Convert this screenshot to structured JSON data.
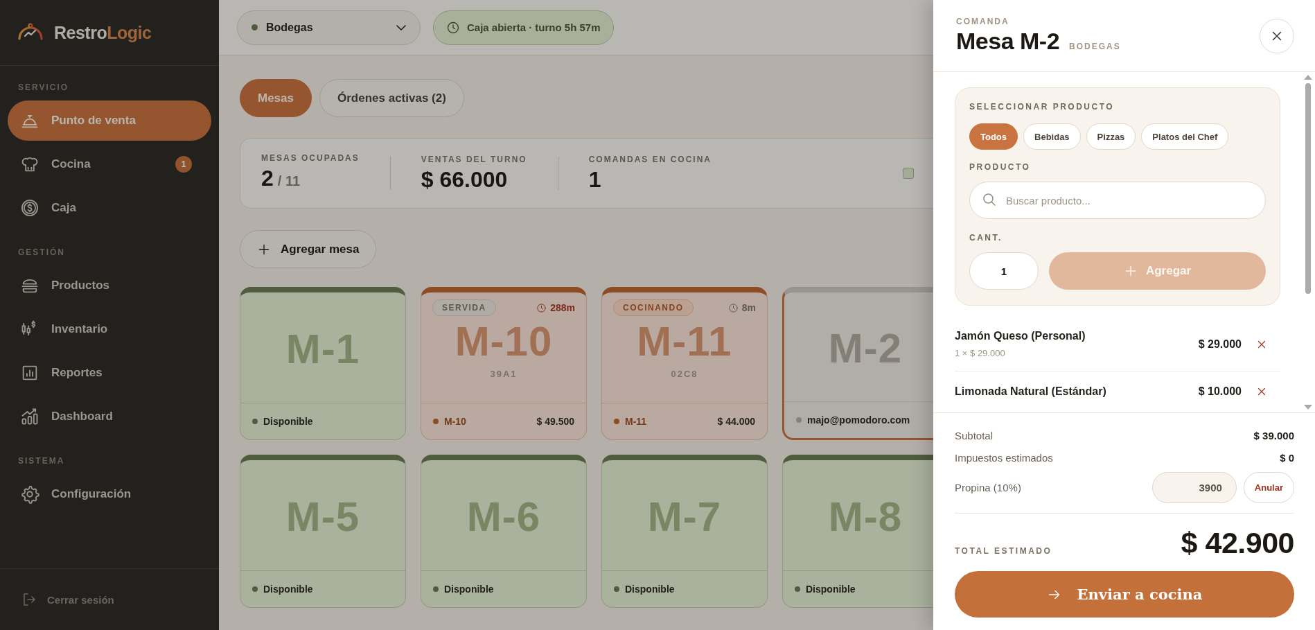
{
  "sidebar": {
    "brand": {
      "name": "Restro",
      "name_accent": "Logic"
    },
    "sections": [
      {
        "title": "SERVICIO",
        "items": [
          {
            "label": "Punto de venta",
            "selected": true
          },
          {
            "label": "Cocina",
            "selected": false,
            "badge": "1"
          },
          {
            "label": "Caja",
            "selected": false
          }
        ]
      },
      {
        "title": "GESTIÓN",
        "items": [
          {
            "label": "Productos",
            "selected": false
          },
          {
            "label": "Inventario",
            "selected": false
          },
          {
            "label": "Reportes",
            "selected": false
          },
          {
            "label": "Dashboard",
            "selected": false
          }
        ]
      },
      {
        "title": "SISTEMA",
        "items": [
          {
            "label": "Configuración",
            "selected": false
          }
        ]
      }
    ],
    "logout": "Cerrar sesión"
  },
  "topbar": {
    "location": {
      "value": "Bodegas"
    },
    "shift_status": "Caja abierta · turno 5h 57m"
  },
  "tabs": [
    {
      "label": "Mesas",
      "selected": true
    },
    {
      "label": "Órdenes activas (2)",
      "selected": false
    }
  ],
  "stats": [
    {
      "label": "MESAS OCUPADAS",
      "value": "2",
      "total": "/ 11"
    },
    {
      "label": "VENTAS DEL TURNO",
      "value": "$ 66.000"
    },
    {
      "label": "COMANDAS EN COCINA",
      "value": "1"
    }
  ],
  "add_table_button": "Agregar mesa",
  "tables": [
    {
      "name": "M-1",
      "kind": "available",
      "selected": false,
      "footer": "Disponible"
    },
    {
      "name": "M-10",
      "kind": "occupied",
      "selected": false,
      "badge": {
        "label": "SERVIDA",
        "kind": "served"
      },
      "timer": "288m",
      "timer_overdue": true,
      "code": "39A1",
      "footer": "M-10",
      "amount": "$ 49.500"
    },
    {
      "name": "M-11",
      "kind": "occupied",
      "selected": false,
      "badge": {
        "label": "COCINANDO",
        "kind": "cooking"
      },
      "timer": "8m",
      "timer_overdue": false,
      "code": "02C8",
      "footer": "M-11",
      "amount": "$ 44.000"
    },
    {
      "name": "M-2",
      "kind": "open",
      "selected": true,
      "footer": "majo@pomodoro.com"
    },
    {
      "name": "M-5",
      "kind": "available",
      "selected": false,
      "footer": "Disponible"
    },
    {
      "name": "M-6",
      "kind": "available",
      "selected": false,
      "footer": "Disponible"
    },
    {
      "name": "M-7",
      "kind": "available",
      "selected": false,
      "footer": "Disponible"
    },
    {
      "name": "M-8",
      "kind": "available",
      "selected": false,
      "footer": "Disponible"
    }
  ],
  "order_panel": {
    "eyebrow": "COMANDA",
    "title": "Mesa M-2",
    "subtitle": "BODEGAS",
    "selector_title": "SELECCIONAR PRODUCTO",
    "categories": [
      {
        "label": "Todos",
        "selected": true
      },
      {
        "label": "Bebidas",
        "selected": false
      },
      {
        "label": "Pizzas",
        "selected": false
      },
      {
        "label": "Platos del Chef",
        "selected": false
      }
    ],
    "product_label": "PRODUCTO",
    "product_search": {
      "placeholder": "Buscar producto..."
    },
    "quantity_label": "CANT.",
    "quantity": "1",
    "add_button": {
      "label": "Agregar",
      "disabled": true
    },
    "items": [
      {
        "name": "Jamón Queso (Personal)",
        "detail": "1 × $ 29.000",
        "price": "$ 29.000"
      },
      {
        "name": "Limonada Natural (Estándar)",
        "price": "$ 10.000"
      }
    ],
    "subtotal": {
      "label": "Subtotal",
      "value": "$ 39.000"
    },
    "taxes": {
      "label": "Impuestos estimados",
      "value": "$ 0"
    },
    "tip": {
      "label": "Propina (10%)",
      "value": "3900",
      "button": "Anular"
    },
    "total": {
      "label": "TOTAL ESTIMADO",
      "value": "$ 42.900"
    },
    "send_button": "Enviar a cocina"
  }
}
